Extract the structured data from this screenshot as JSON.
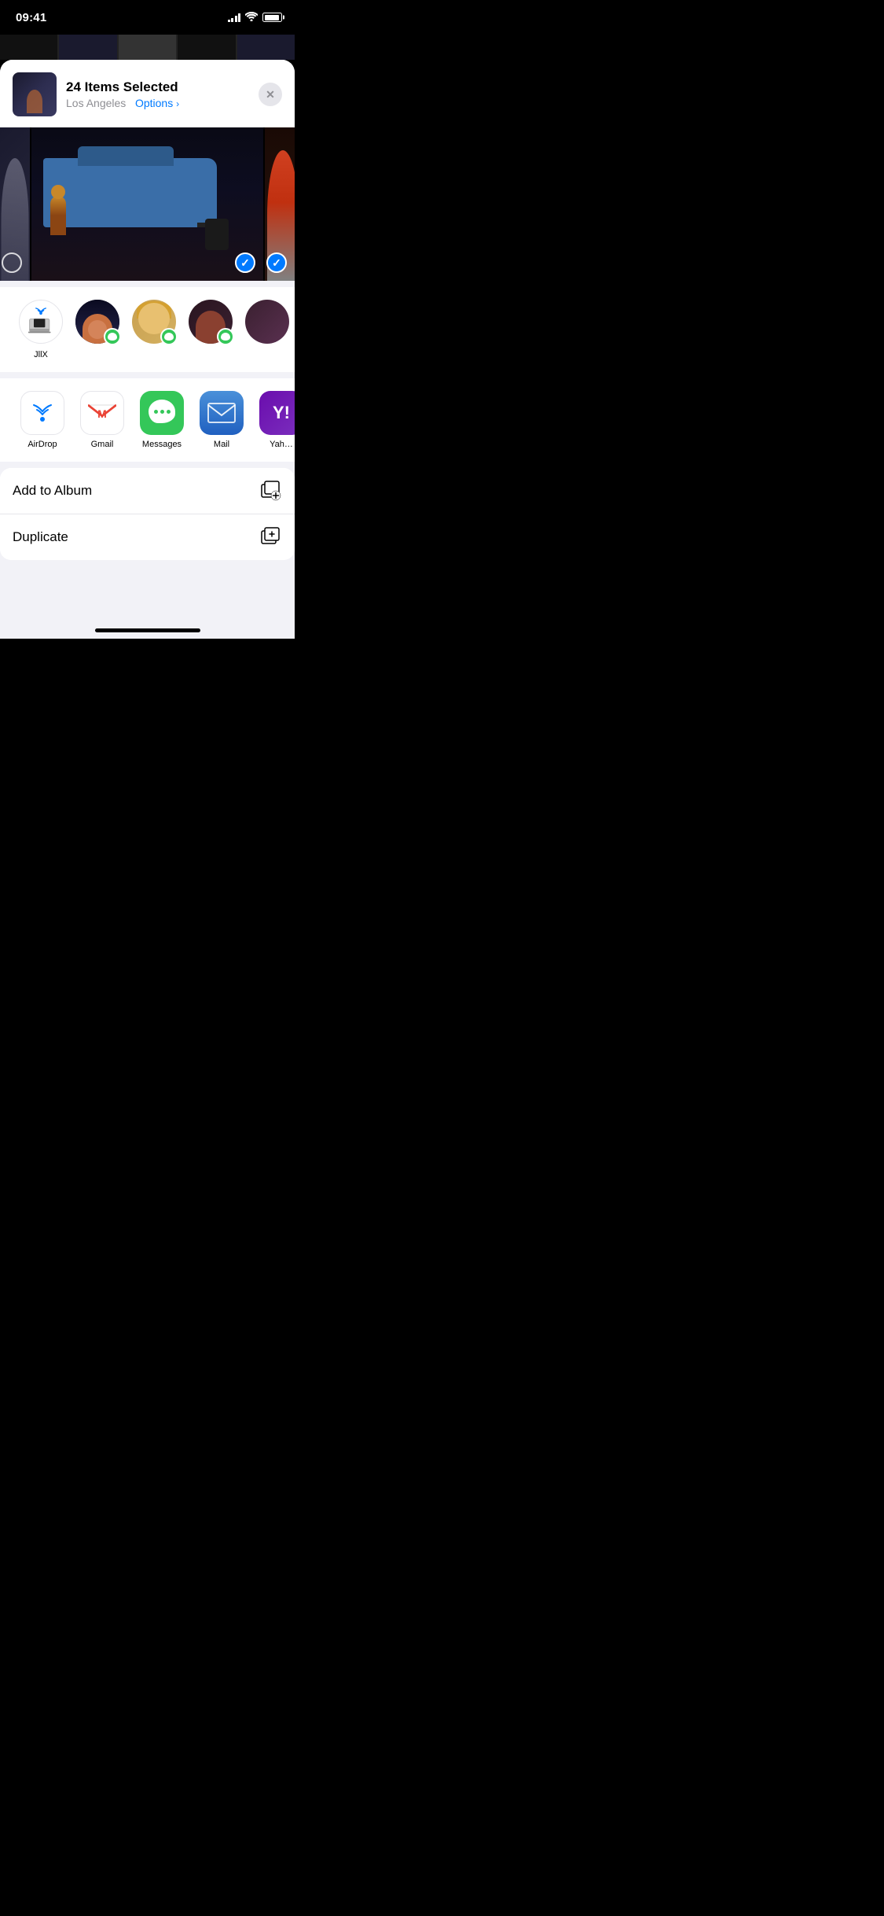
{
  "statusBar": {
    "time": "09:41",
    "signalBars": [
      3,
      6,
      9,
      11,
      13
    ],
    "battery": 90
  },
  "shareHeader": {
    "title": "24 Items Selected",
    "location": "Los Angeles",
    "optionsLabel": "Options",
    "closeLabel": "✕"
  },
  "contacts": [
    {
      "name": "JllX",
      "type": "airdrop"
    },
    {
      "name": "",
      "type": "person1"
    },
    {
      "name": "",
      "type": "person2"
    },
    {
      "name": "",
      "type": "person3"
    },
    {
      "name": "",
      "type": "person4"
    }
  ],
  "apps": [
    {
      "name": "AirDrop",
      "type": "airdrop"
    },
    {
      "name": "Gmail",
      "type": "gmail"
    },
    {
      "name": "Messages",
      "type": "messages"
    },
    {
      "name": "Mail",
      "type": "mail"
    },
    {
      "name": "Yah…",
      "type": "yahoo"
    }
  ],
  "actions": [
    {
      "label": "Add to Album",
      "icon": "add-album-icon"
    },
    {
      "label": "Duplicate",
      "icon": "duplicate-icon"
    }
  ]
}
